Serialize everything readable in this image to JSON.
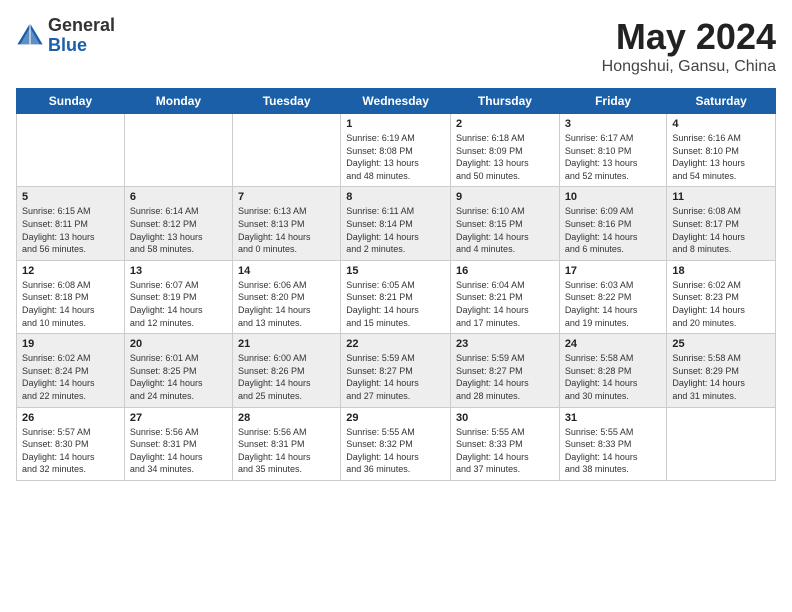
{
  "header": {
    "logo_general": "General",
    "logo_blue": "Blue",
    "month_title": "May 2024",
    "location": "Hongshui, Gansu, China"
  },
  "days_of_week": [
    "Sunday",
    "Monday",
    "Tuesday",
    "Wednesday",
    "Thursday",
    "Friday",
    "Saturday"
  ],
  "weeks": [
    [
      {
        "day": "",
        "content": ""
      },
      {
        "day": "",
        "content": ""
      },
      {
        "day": "",
        "content": ""
      },
      {
        "day": "1",
        "content": "Sunrise: 6:19 AM\nSunset: 8:08 PM\nDaylight: 13 hours\nand 48 minutes."
      },
      {
        "day": "2",
        "content": "Sunrise: 6:18 AM\nSunset: 8:09 PM\nDaylight: 13 hours\nand 50 minutes."
      },
      {
        "day": "3",
        "content": "Sunrise: 6:17 AM\nSunset: 8:10 PM\nDaylight: 13 hours\nand 52 minutes."
      },
      {
        "day": "4",
        "content": "Sunrise: 6:16 AM\nSunset: 8:10 PM\nDaylight: 13 hours\nand 54 minutes."
      }
    ],
    [
      {
        "day": "5",
        "content": "Sunrise: 6:15 AM\nSunset: 8:11 PM\nDaylight: 13 hours\nand 56 minutes."
      },
      {
        "day": "6",
        "content": "Sunrise: 6:14 AM\nSunset: 8:12 PM\nDaylight: 13 hours\nand 58 minutes."
      },
      {
        "day": "7",
        "content": "Sunrise: 6:13 AM\nSunset: 8:13 PM\nDaylight: 14 hours\nand 0 minutes."
      },
      {
        "day": "8",
        "content": "Sunrise: 6:11 AM\nSunset: 8:14 PM\nDaylight: 14 hours\nand 2 minutes."
      },
      {
        "day": "9",
        "content": "Sunrise: 6:10 AM\nSunset: 8:15 PM\nDaylight: 14 hours\nand 4 minutes."
      },
      {
        "day": "10",
        "content": "Sunrise: 6:09 AM\nSunset: 8:16 PM\nDaylight: 14 hours\nand 6 minutes."
      },
      {
        "day": "11",
        "content": "Sunrise: 6:08 AM\nSunset: 8:17 PM\nDaylight: 14 hours\nand 8 minutes."
      }
    ],
    [
      {
        "day": "12",
        "content": "Sunrise: 6:08 AM\nSunset: 8:18 PM\nDaylight: 14 hours\nand 10 minutes."
      },
      {
        "day": "13",
        "content": "Sunrise: 6:07 AM\nSunset: 8:19 PM\nDaylight: 14 hours\nand 12 minutes."
      },
      {
        "day": "14",
        "content": "Sunrise: 6:06 AM\nSunset: 8:20 PM\nDaylight: 14 hours\nand 13 minutes."
      },
      {
        "day": "15",
        "content": "Sunrise: 6:05 AM\nSunset: 8:21 PM\nDaylight: 14 hours\nand 15 minutes."
      },
      {
        "day": "16",
        "content": "Sunrise: 6:04 AM\nSunset: 8:21 PM\nDaylight: 14 hours\nand 17 minutes."
      },
      {
        "day": "17",
        "content": "Sunrise: 6:03 AM\nSunset: 8:22 PM\nDaylight: 14 hours\nand 19 minutes."
      },
      {
        "day": "18",
        "content": "Sunrise: 6:02 AM\nSunset: 8:23 PM\nDaylight: 14 hours\nand 20 minutes."
      }
    ],
    [
      {
        "day": "19",
        "content": "Sunrise: 6:02 AM\nSunset: 8:24 PM\nDaylight: 14 hours\nand 22 minutes."
      },
      {
        "day": "20",
        "content": "Sunrise: 6:01 AM\nSunset: 8:25 PM\nDaylight: 14 hours\nand 24 minutes."
      },
      {
        "day": "21",
        "content": "Sunrise: 6:00 AM\nSunset: 8:26 PM\nDaylight: 14 hours\nand 25 minutes."
      },
      {
        "day": "22",
        "content": "Sunrise: 5:59 AM\nSunset: 8:27 PM\nDaylight: 14 hours\nand 27 minutes."
      },
      {
        "day": "23",
        "content": "Sunrise: 5:59 AM\nSunset: 8:27 PM\nDaylight: 14 hours\nand 28 minutes."
      },
      {
        "day": "24",
        "content": "Sunrise: 5:58 AM\nSunset: 8:28 PM\nDaylight: 14 hours\nand 30 minutes."
      },
      {
        "day": "25",
        "content": "Sunrise: 5:58 AM\nSunset: 8:29 PM\nDaylight: 14 hours\nand 31 minutes."
      }
    ],
    [
      {
        "day": "26",
        "content": "Sunrise: 5:57 AM\nSunset: 8:30 PM\nDaylight: 14 hours\nand 32 minutes."
      },
      {
        "day": "27",
        "content": "Sunrise: 5:56 AM\nSunset: 8:31 PM\nDaylight: 14 hours\nand 34 minutes."
      },
      {
        "day": "28",
        "content": "Sunrise: 5:56 AM\nSunset: 8:31 PM\nDaylight: 14 hours\nand 35 minutes."
      },
      {
        "day": "29",
        "content": "Sunrise: 5:55 AM\nSunset: 8:32 PM\nDaylight: 14 hours\nand 36 minutes."
      },
      {
        "day": "30",
        "content": "Sunrise: 5:55 AM\nSunset: 8:33 PM\nDaylight: 14 hours\nand 37 minutes."
      },
      {
        "day": "31",
        "content": "Sunrise: 5:55 AM\nSunset: 8:33 PM\nDaylight: 14 hours\nand 38 minutes."
      },
      {
        "day": "",
        "content": ""
      }
    ]
  ]
}
